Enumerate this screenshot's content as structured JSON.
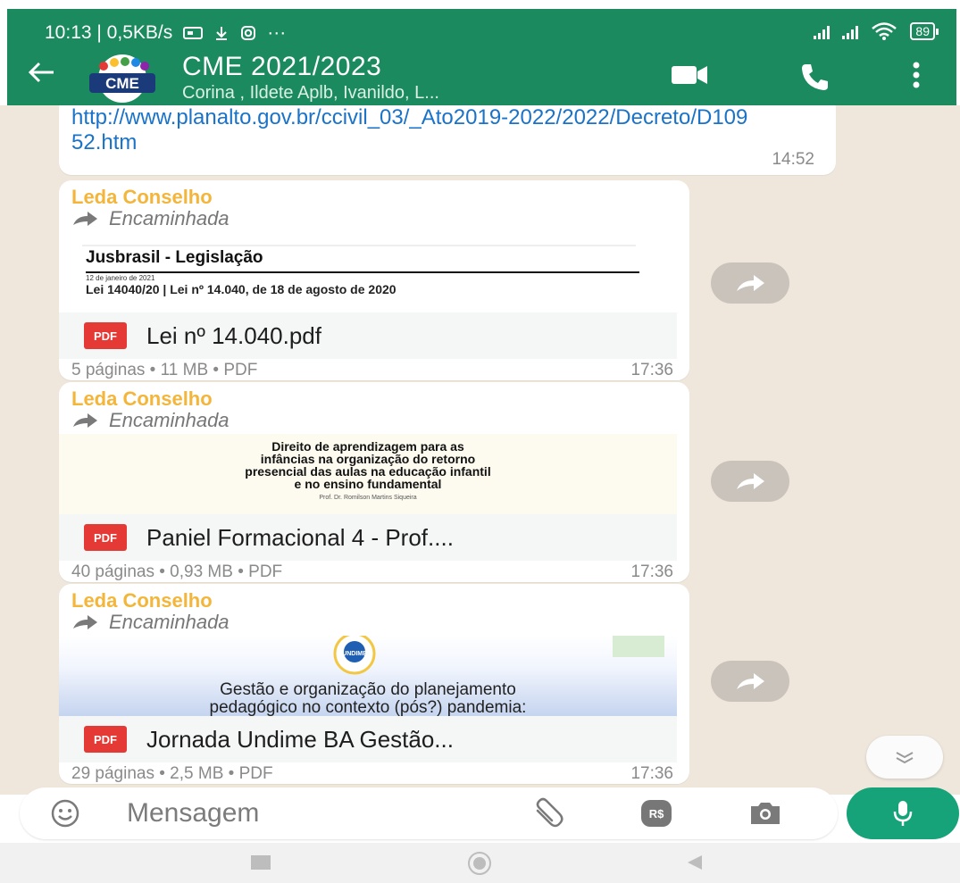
{
  "status_bar": {
    "left_text": "10:13 | 0,5KB/s",
    "extra": "···",
    "battery": "89"
  },
  "chat_header": {
    "avatar_text": "CME",
    "title": "CME 2021/2023",
    "subtitle": "Corina , Ildete Aplb, Ivanildo, L..."
  },
  "link_message": {
    "text": "http://www.planalto.gov.br/ccivil_03/_Ato2019-2022/2022/Decreto/D10952.htm",
    "time": "14:52"
  },
  "messages": [
    {
      "sender": "Leda Conselho",
      "forwarded": "Encaminhada",
      "preview": {
        "title": "Jusbrasil - Legislação",
        "date": "12 de janeiro de 2021",
        "subtitle": "Lei 14040/20 | Lei nº 14.040, de 18 de agosto de 2020"
      },
      "file_type": "PDF",
      "file_name": "Lei nº 14.040.pdf",
      "meta": "5 páginas • 11 MB • PDF",
      "time": "17:36"
    },
    {
      "sender": "Leda Conselho",
      "forwarded": "Encaminhada",
      "preview": {
        "line1": "Direito de aprendizagem para as",
        "line2": "infâncias na organização do retorno",
        "line3": "presencial das aulas na educação infantil",
        "line4": "e no ensino fundamental",
        "author": "Prof. Dr. Romilson Martins Siqueira"
      },
      "file_type": "PDF",
      "file_name": "Paniel Formacional 4 - Prof....",
      "meta": "40 páginas • 0,93 MB • PDF",
      "time": "17:36"
    },
    {
      "sender": "Leda Conselho",
      "forwarded": "Encaminhada",
      "preview": {
        "badge": "UNDIME",
        "line1": "Gestão e organização do planejamento",
        "line2": "pedagógico no contexto (pós?) pandemia:"
      },
      "file_type": "PDF",
      "file_name": "Jornada Undime BA Gestão...",
      "meta": "29 páginas • 2,5 MB • PDF",
      "time": "17:36"
    }
  ],
  "composer": {
    "placeholder": "Mensagem",
    "currency_label": "R$"
  },
  "colors": {
    "header": "#1b8a5e",
    "chat_bg": "#efe7dc",
    "sender": "#f3b53a",
    "link": "#1a73c8",
    "mic": "#16a37a"
  }
}
